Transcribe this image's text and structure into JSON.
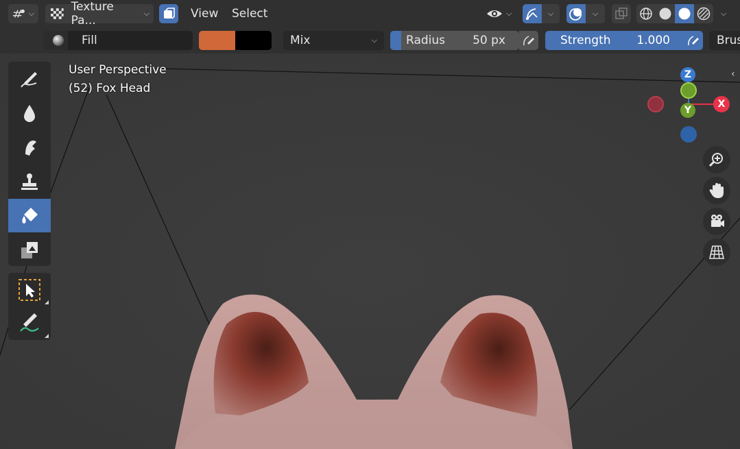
{
  "header": {
    "editor_type_icon": "viewport-editor-icon",
    "mode_label": "Texture Pa...",
    "menu_view": "View",
    "menu_select": "Select"
  },
  "toolbar": {
    "fill_label": "Fill",
    "primary_color": "#d0683a",
    "secondary_color": "#000000",
    "blend_mode": "Mix",
    "radius_label": "Radius",
    "radius_value": "50 px",
    "strength_label": "Strength",
    "strength_value": "1.000",
    "brush_label": "Brus"
  },
  "viewport": {
    "perspective_label": "User Perspective",
    "object_label": "(52) Fox Head",
    "gizmo": {
      "z": "Z",
      "y": "Y",
      "x": "X"
    }
  },
  "tools": [
    {
      "name": "draw-brush-icon"
    },
    {
      "name": "soften-icon"
    },
    {
      "name": "smear-icon"
    },
    {
      "name": "clone-stamp-icon"
    },
    {
      "name": "fill-bucket-icon",
      "active": true
    },
    {
      "name": "mask-icon"
    },
    {
      "name": "select-box-icon"
    },
    {
      "name": "annotate-icon"
    }
  ],
  "colors": {
    "accent": "#4772b3",
    "axis_x": "#e8334a",
    "axis_y": "#6c9e2b",
    "axis_z": "#3a7bd0"
  }
}
